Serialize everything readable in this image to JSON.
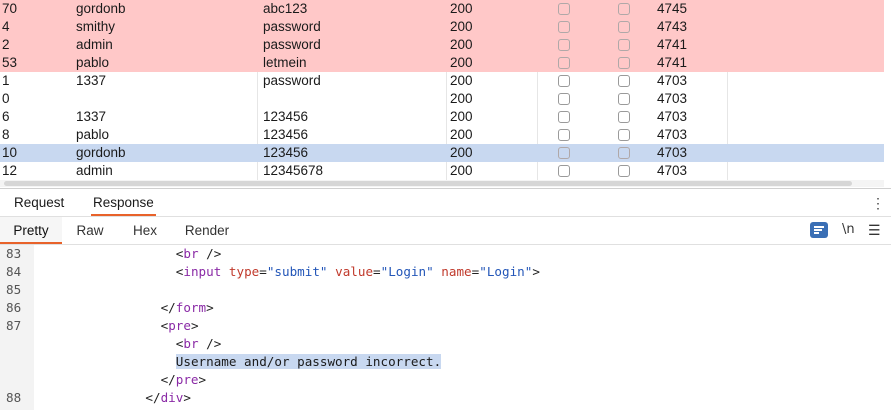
{
  "results": {
    "rows": [
      {
        "num": "70",
        "user": "gordonb",
        "pass": "abc123",
        "status": "200",
        "len": "4745",
        "hl": "red"
      },
      {
        "num": "4",
        "user": "smithy",
        "pass": "password",
        "status": "200",
        "len": "4743",
        "hl": "red"
      },
      {
        "num": "2",
        "user": "admin",
        "pass": "password",
        "status": "200",
        "len": "4741",
        "hl": "red"
      },
      {
        "num": "53",
        "user": "pablo",
        "pass": "letmein",
        "status": "200",
        "len": "4741",
        "hl": "red"
      },
      {
        "num": "1",
        "user": "1337",
        "pass": "password",
        "status": "200",
        "len": "4703",
        "hl": ""
      },
      {
        "num": "0",
        "user": "",
        "pass": "",
        "status": "200",
        "len": "4703",
        "hl": ""
      },
      {
        "num": "6",
        "user": "1337",
        "pass": "123456",
        "status": "200",
        "len": "4703",
        "hl": ""
      },
      {
        "num": "8",
        "user": "pablo",
        "pass": "123456",
        "status": "200",
        "len": "4703",
        "hl": ""
      },
      {
        "num": "10",
        "user": "gordonb",
        "pass": "123456",
        "status": "200",
        "len": "4703",
        "hl": "blue"
      },
      {
        "num": "12",
        "user": "admin",
        "pass": "12345678",
        "status": "200",
        "len": "4703",
        "hl": ""
      }
    ]
  },
  "message_tabs": {
    "request": "Request",
    "response": "Response",
    "active": "response"
  },
  "view_tabs": {
    "pretty": "Pretty",
    "raw": "Raw",
    "hex": "Hex",
    "render": "Render",
    "active": "pretty"
  },
  "toolbar": {
    "newline_label": "\\n"
  },
  "code": {
    "lines": [
      {
        "n": "83",
        "indent": 18,
        "tokens": [
          [
            "p",
            "<"
          ],
          [
            "t",
            "br"
          ],
          [
            "p",
            " />"
          ]
        ]
      },
      {
        "n": "84",
        "indent": 18,
        "tokens": [
          [
            "p",
            "<"
          ],
          [
            "t",
            "input"
          ],
          [
            "p",
            " "
          ],
          [
            "a",
            "type"
          ],
          [
            "p",
            "="
          ],
          [
            "s",
            "\"submit\""
          ],
          [
            "p",
            " "
          ],
          [
            "a",
            "value"
          ],
          [
            "p",
            "="
          ],
          [
            "s",
            "\"Login\""
          ],
          [
            "p",
            " "
          ],
          [
            "a",
            "name"
          ],
          [
            "p",
            "="
          ],
          [
            "s",
            "\"Login\""
          ],
          [
            "p",
            ">"
          ]
        ]
      },
      {
        "n": "85",
        "indent": 0,
        "tokens": []
      },
      {
        "n": "86",
        "indent": 16,
        "tokens": [
          [
            "p",
            "</"
          ],
          [
            "t",
            "form"
          ],
          [
            "p",
            ">"
          ]
        ]
      },
      {
        "n": "87",
        "indent": 16,
        "tokens": [
          [
            "p",
            "<"
          ],
          [
            "t",
            "pre"
          ],
          [
            "p",
            ">"
          ]
        ]
      },
      {
        "n": "",
        "indent": 18,
        "tokens": [
          [
            "p",
            "<"
          ],
          [
            "t",
            "br"
          ],
          [
            "p",
            " />"
          ]
        ]
      },
      {
        "n": "",
        "indent": 18,
        "tokens": [
          [
            "sel",
            "Username and/or password incorrect."
          ]
        ]
      },
      {
        "n": "",
        "indent": 16,
        "tokens": [
          [
            "p",
            "</"
          ],
          [
            "t",
            "pre"
          ],
          [
            "p",
            ">"
          ]
        ]
      },
      {
        "n": "88",
        "indent": 14,
        "tokens": [
          [
            "p",
            "</"
          ],
          [
            "t",
            "div"
          ],
          [
            "p",
            ">"
          ]
        ]
      }
    ]
  },
  "colors": {
    "accent": "#e8622a",
    "highlight_red": "#ffc8c8",
    "highlight_blue": "#c8d8f0",
    "wrap_button": "#3a6fb5"
  }
}
